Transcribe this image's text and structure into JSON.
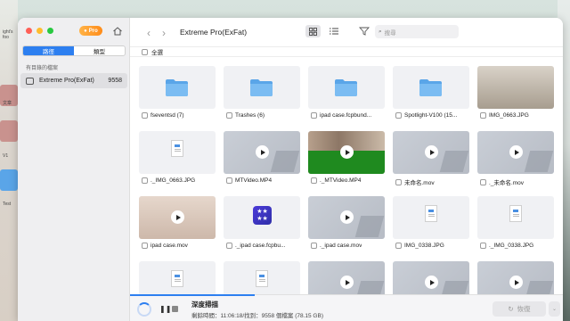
{
  "desktop": {
    "labels": [
      "ight's foo",
      "文章",
      "V1",
      "Test"
    ]
  },
  "sidebar": {
    "pro_badge": "Pro",
    "tabs": [
      {
        "label": "路徑",
        "active": true
      },
      {
        "label": "類型",
        "active": false
      }
    ],
    "section_title": "有目錄的檔案",
    "items": [
      {
        "label": "Extreme Pro(ExFat)",
        "count": "9558"
      }
    ]
  },
  "toolbar": {
    "title": "Extreme Pro(ExFat)",
    "search_placeholder": "搜尋"
  },
  "select_all_label": "全選",
  "files": [
    {
      "name": "fseventsd (7)",
      "kind": "folder"
    },
    {
      "name": "Trashes (6)",
      "kind": "folder"
    },
    {
      "name": "ipad case.fcpbund...",
      "kind": "folder"
    },
    {
      "name": "Spotlight-V100 (15...",
      "kind": "folder"
    },
    {
      "name": "IMG_0663.JPG",
      "kind": "photo-desk"
    },
    {
      "name": "._IMG_0663.JPG",
      "kind": "doc"
    },
    {
      "name": "MTVideo.MP4",
      "kind": "video"
    },
    {
      "name": "._MTVideo.MP4",
      "kind": "video-green"
    },
    {
      "name": "未命名.mov",
      "kind": "video"
    },
    {
      "name": "._未命名.mov",
      "kind": "video"
    },
    {
      "name": "ipad case.mov",
      "kind": "video-person"
    },
    {
      "name": "._ipad case.fcpbu...",
      "kind": "stars"
    },
    {
      "name": "._ipad case.mov",
      "kind": "video"
    },
    {
      "name": "IMG_0338.JPG",
      "kind": "doc"
    },
    {
      "name": "._IMG_0338.JPG",
      "kind": "doc"
    },
    {
      "name": "",
      "kind": "doc"
    },
    {
      "name": "",
      "kind": "doc"
    },
    {
      "name": "",
      "kind": "video"
    },
    {
      "name": "",
      "kind": "video"
    },
    {
      "name": "",
      "kind": "video"
    }
  ],
  "scan": {
    "title": "深度掃描",
    "detail": "剩餘時間：11:06:18/找到：9558 個檔案 (78.15 GB)"
  },
  "recover_label": "恢復",
  "colors": {
    "accent": "#2d7ff0",
    "folder": "#5aa5e8",
    "close": "#ff5f57",
    "minimize": "#febc2e",
    "maximize": "#28c840"
  }
}
